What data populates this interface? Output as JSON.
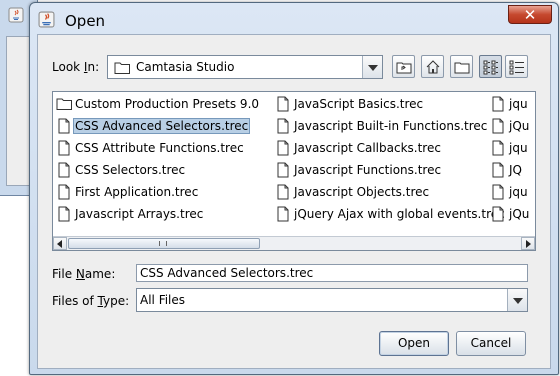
{
  "dialog": {
    "title": "Open",
    "close_glyph": "✕"
  },
  "look_in": {
    "label_prefix": "Look ",
    "label_mnemonic": "I",
    "label_suffix": "n:",
    "value": "Camtasia Studio",
    "icon": "folder-icon"
  },
  "toolbar": {
    "buttons": [
      {
        "name": "up-one-level",
        "icon": "up-folder-icon"
      },
      {
        "name": "home",
        "icon": "home-icon"
      },
      {
        "name": "new-folder",
        "icon": "new-folder-icon"
      },
      {
        "name": "list-view",
        "icon": "list-view-icon",
        "selected": true
      },
      {
        "name": "details-view",
        "icon": "details-view-icon",
        "selected": false
      }
    ]
  },
  "files": {
    "column1": [
      {
        "label": "Custom Production Presets 9.0",
        "type": "folder"
      },
      {
        "label": "CSS Advanced Selectors.trec",
        "type": "file",
        "selected": true
      },
      {
        "label": "CSS Attribute Functions.trec",
        "type": "file"
      },
      {
        "label": "CSS Selectors.trec",
        "type": "file"
      },
      {
        "label": "First Application.trec",
        "type": "file"
      },
      {
        "label": "Javascript Arrays.trec",
        "type": "file"
      }
    ],
    "column2": [
      {
        "label": "JavaScript Basics.trec",
        "type": "file"
      },
      {
        "label": "Javascript Built-in Functions.trec",
        "type": "file"
      },
      {
        "label": "Javascript Callbacks.trec",
        "type": "file"
      },
      {
        "label": "Javascript Functions.trec",
        "type": "file"
      },
      {
        "label": "Javascript Objects.trec",
        "type": "file"
      },
      {
        "label": "jQuery Ajax with global events.trec",
        "type": "file"
      }
    ],
    "column3": [
      {
        "label": "jqu",
        "type": "file"
      },
      {
        "label": "jQu",
        "type": "file"
      },
      {
        "label": "jqu",
        "type": "file"
      },
      {
        "label": "JQ",
        "type": "file"
      },
      {
        "label": "jqu",
        "type": "file"
      },
      {
        "label": "jQu",
        "type": "file"
      }
    ]
  },
  "file_name": {
    "label_prefix": "File ",
    "label_mnemonic": "N",
    "label_suffix": "ame:",
    "value": "CSS Advanced Selectors.trec"
  },
  "files_of_type": {
    "label_prefix": "Files of ",
    "label_mnemonic": "T",
    "label_suffix": "ype:",
    "value": "All Files"
  },
  "buttons": {
    "open": "Open",
    "cancel": "Cancel"
  }
}
